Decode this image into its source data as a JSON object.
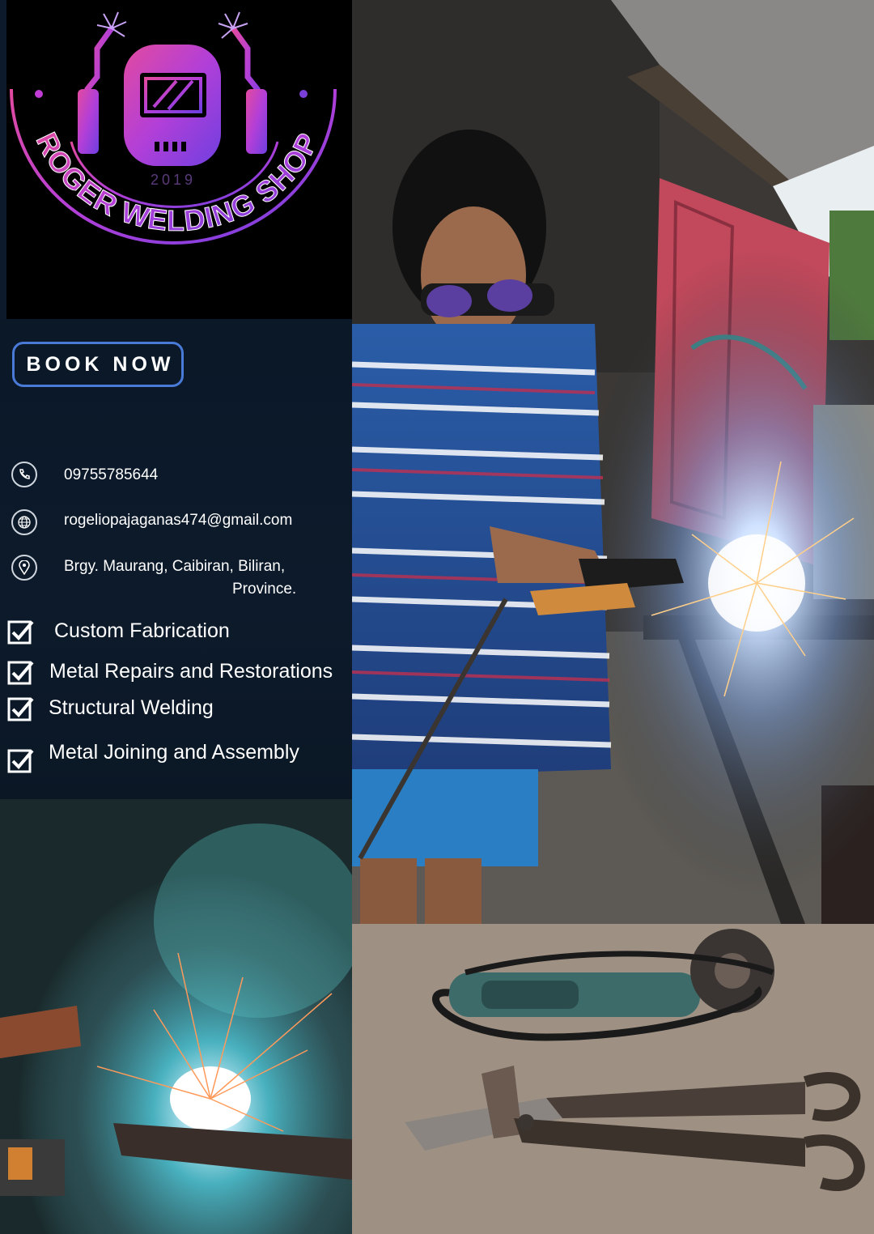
{
  "logo": {
    "name_text": "ROGER WELDING SHOP",
    "year": "2019",
    "accent_colors": [
      "#c13cd6",
      "#7b3fd9",
      "#e0489a"
    ]
  },
  "cta": {
    "book_label": "BOOK NOW",
    "border_color": "#4a7ad8"
  },
  "contact": {
    "phone": {
      "icon": "phone-icon",
      "text": "09755785644"
    },
    "email": {
      "icon": "globe-icon",
      "text": "rogeliopajaganas474@gmail.com"
    },
    "address": {
      "icon": "location-pin-icon",
      "line1": "Brgy. Maurang, Caibiran, Biliran,",
      "line2": "Province."
    }
  },
  "services": [
    {
      "icon": "checkbox-checked-icon",
      "label": "Custom Fabrication"
    },
    {
      "icon": "checkbox-checked-icon",
      "label": "Metal Repairs and Restorations"
    },
    {
      "icon": "checkbox-checked-icon",
      "label": "Structural Welding"
    },
    {
      "icon": "checkbox-checked-icon",
      "label": "Metal Joining and Assembly"
    }
  ]
}
